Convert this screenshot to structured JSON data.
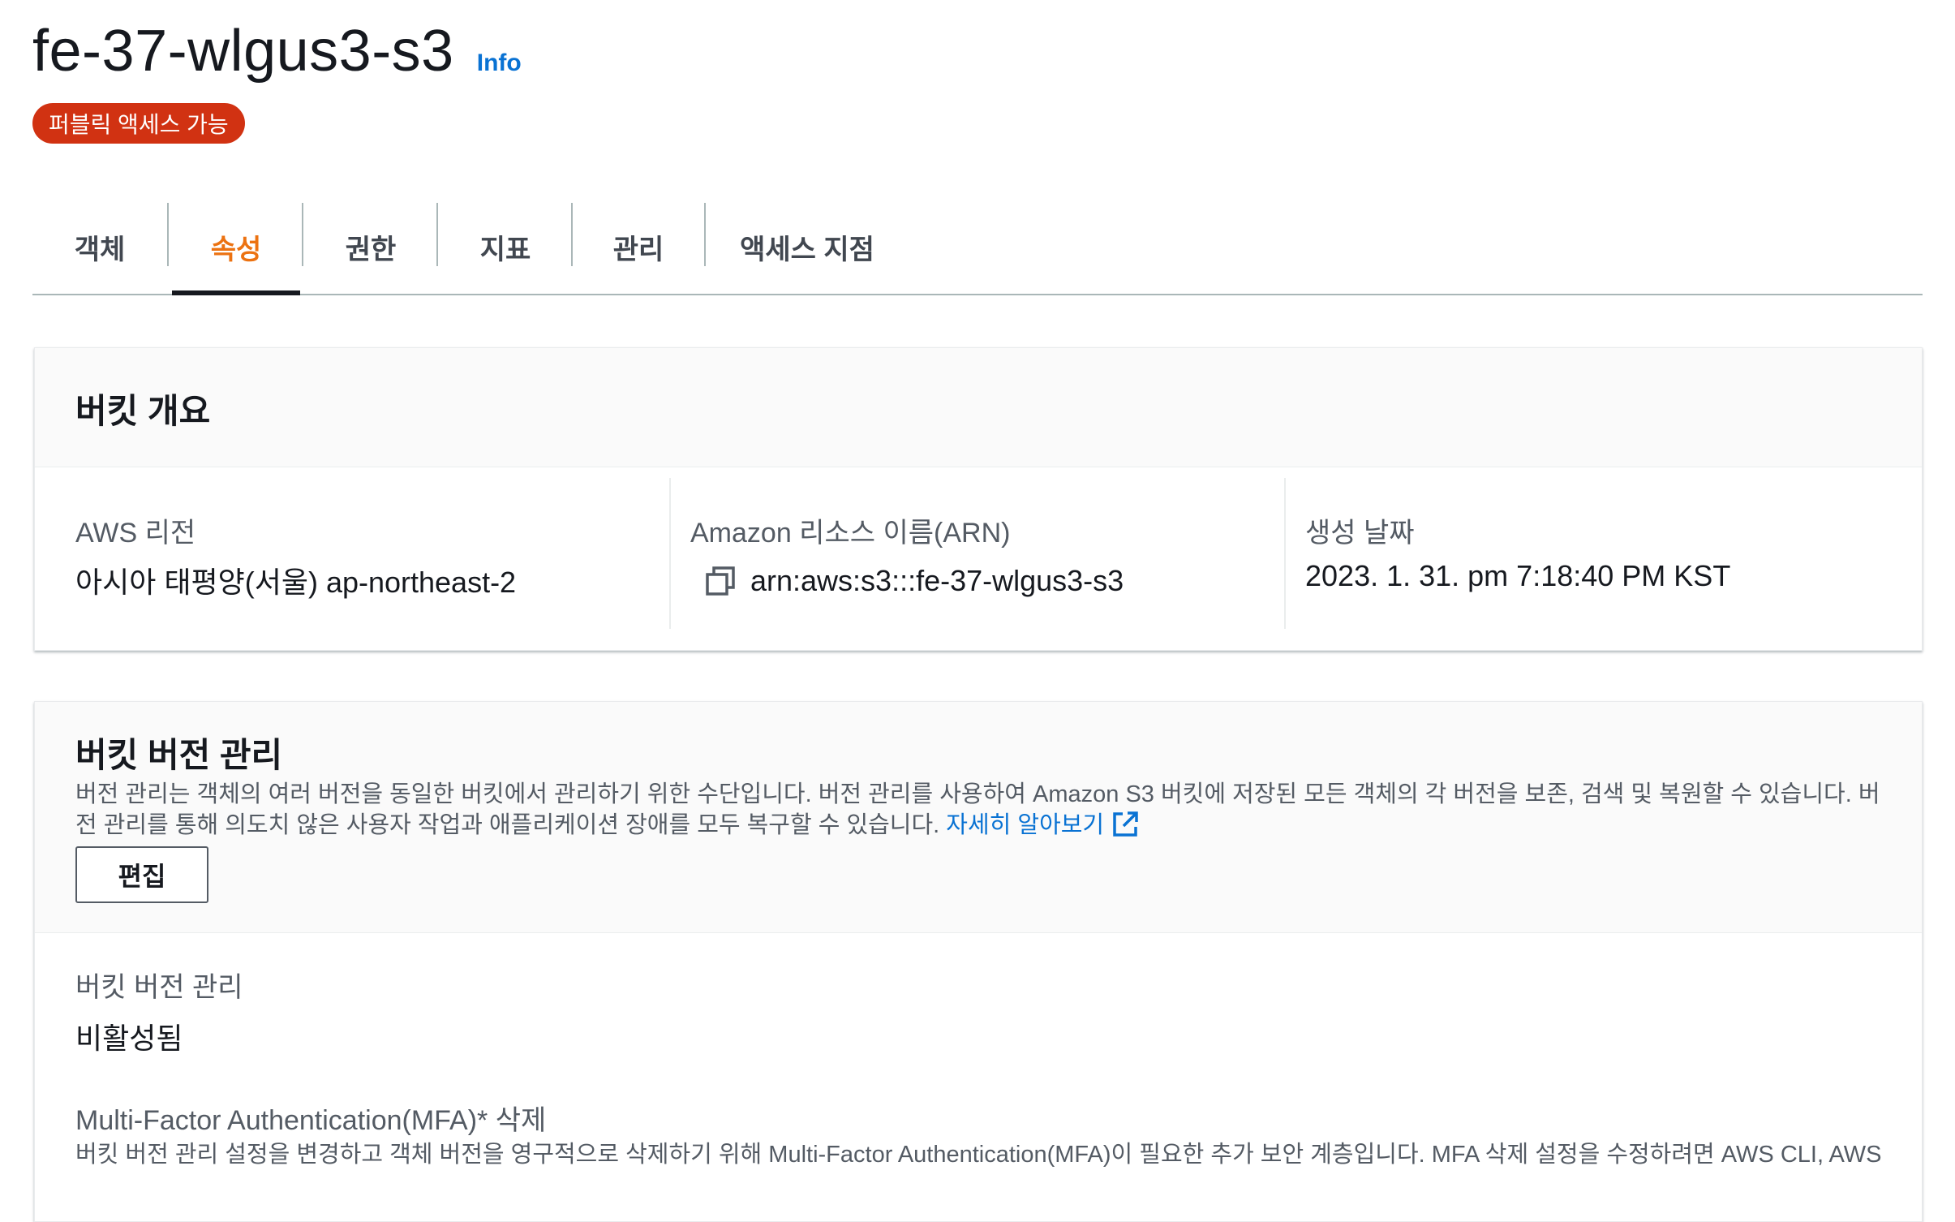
{
  "header": {
    "bucket_name": "fe-37-wlgus3-s3",
    "info_label": "Info",
    "public_badge": "퍼블릭 액세스 가능"
  },
  "tabs": [
    {
      "label": "객체",
      "active": false
    },
    {
      "label": "속성",
      "active": true
    },
    {
      "label": "권한",
      "active": false
    },
    {
      "label": "지표",
      "active": false
    },
    {
      "label": "관리",
      "active": false
    },
    {
      "label": "액세스 지점",
      "active": false
    }
  ],
  "overview": {
    "title": "버킷 개요",
    "region_label": "AWS 리전",
    "region_value": "아시아 태평양(서울) ap-northeast-2",
    "arn_label": "Amazon 리소스 이름(ARN)",
    "arn_value": "arn:aws:s3:::fe-37-wlgus3-s3",
    "created_label": "생성 날짜",
    "created_value": "2023. 1. 31. pm 7:18:40 PM KST"
  },
  "versioning": {
    "title": "버킷 버전 관리",
    "description": "버전 관리는 객체의 여러 버전을 동일한 버킷에서 관리하기 위한 수단입니다. 버전 관리를 사용하여 Amazon S3 버킷에 저장된 모든 객체의 각 버전을 보존, 검색 및 복원할 수 있습니다. 버전 관리를 통해 의도치 않은 사용자 작업과 애플리케이션 장애를 모두 복구할 수 있습니다.",
    "learn_more": "자세히 알아보기",
    "edit_label": "편집",
    "status_label": "버킷 버전 관리",
    "status_value": "비활성됨",
    "mfa_label": "Multi-Factor Authentication(MFA)* 삭제",
    "mfa_description": "버킷 버전 관리 설정을 변경하고 객체 버전을 영구적으로 삭제하기 위해 Multi-Factor Authentication(MFA)이 필요한 추가 보안 계층입니다. MFA 삭제 설정을 수정하려면 AWS CLI, AWS"
  },
  "colors": {
    "accent_tab": "#ec7211",
    "link": "#0972d3",
    "badge": "#d13212"
  },
  "icons": {
    "copy": "copy-icon",
    "external": "external-link-icon"
  }
}
